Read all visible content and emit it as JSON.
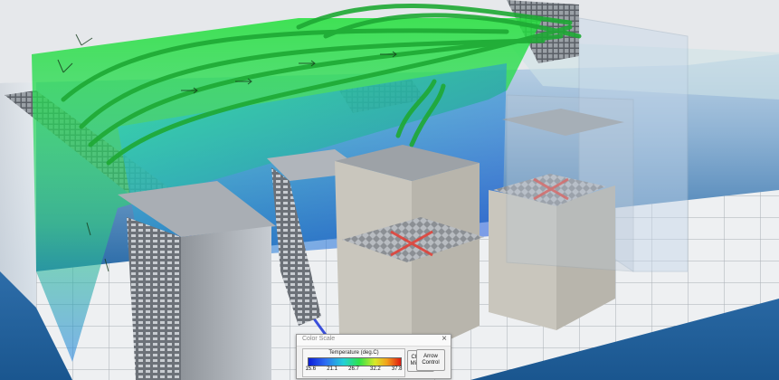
{
  "color_scale_panel": {
    "title": "Color Scale",
    "close_glyph": "×",
    "scale_label": "Temperature (deg.C)",
    "ticks": [
      "15.6",
      "21.1",
      "26.7",
      "32.2",
      "37.8"
    ],
    "change_minmax_label": "Change Min/Max",
    "arrow_control_label": "Arrow Control"
  },
  "colors": {
    "scale_min": "#0b1dd8",
    "scale_mid": "#2fe24a",
    "scale_max": "#e01a10",
    "background": "#1f5f99",
    "airflow": "#22e03a",
    "blocked_marker": "#e0433a"
  }
}
